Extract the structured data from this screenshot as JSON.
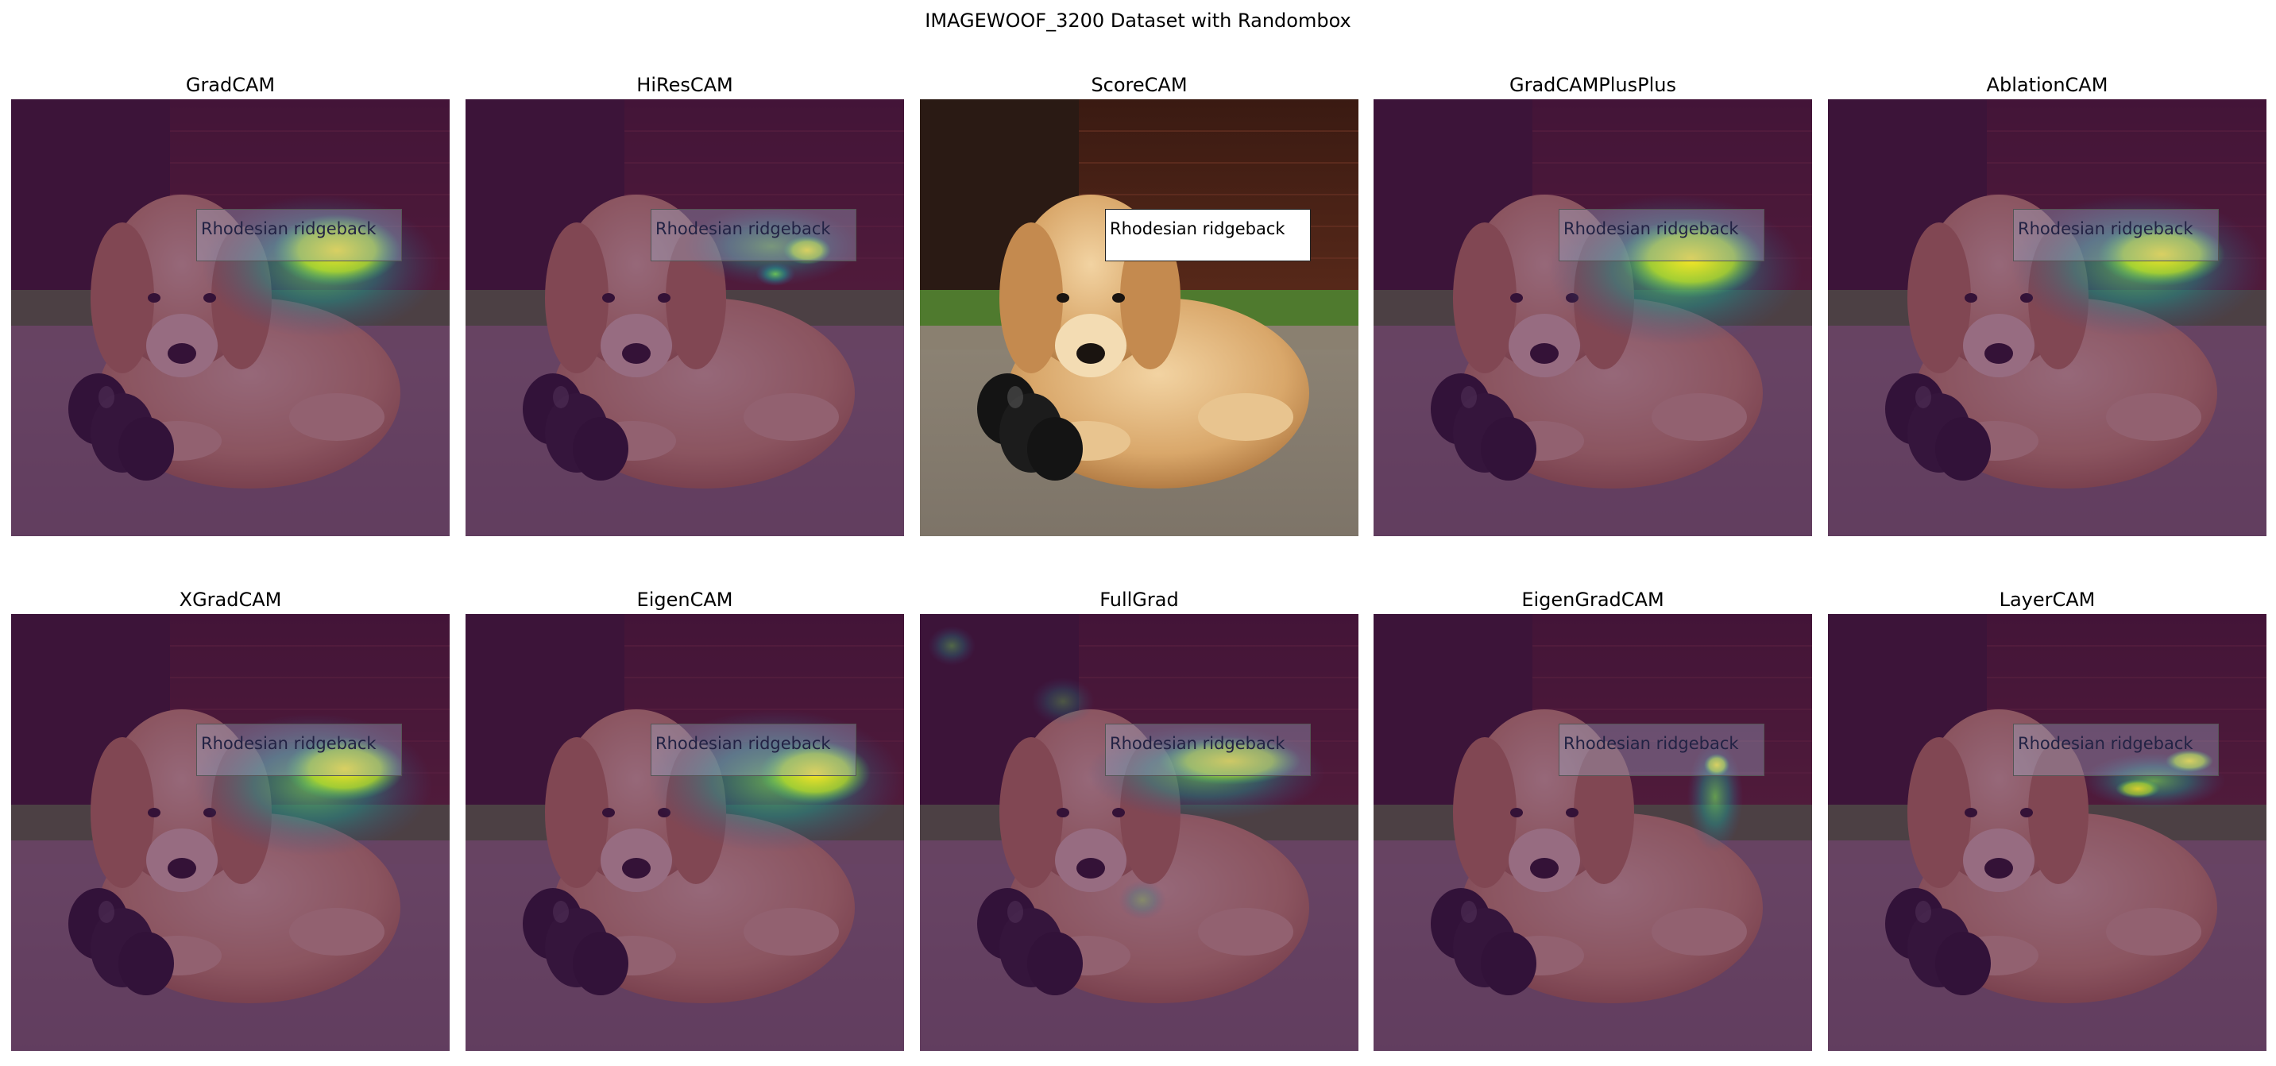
{
  "figure": {
    "title": "IMAGEWOOF_3200 Dataset with Randombox",
    "box_label": "Rhodesian ridgeback"
  },
  "panels": [
    {
      "method": "GradCAM",
      "overlay": "heatmap"
    },
    {
      "method": "HiResCAM",
      "overlay": "heatmap"
    },
    {
      "method": "ScoreCAM",
      "overlay": "none"
    },
    {
      "method": "GradCAMPlusPlus",
      "overlay": "heatmap"
    },
    {
      "method": "AblationCAM",
      "overlay": "heatmap"
    },
    {
      "method": "XGradCAM",
      "overlay": "heatmap"
    },
    {
      "method": "EigenCAM",
      "overlay": "heatmap"
    },
    {
      "method": "FullGrad",
      "overlay": "heatmap"
    },
    {
      "method": "EigenGradCAM",
      "overlay": "heatmap"
    },
    {
      "method": "LayerCAM",
      "overlay": "heatmap"
    }
  ],
  "colors": {
    "overlay_base": "#4a1058",
    "heat_mid": "#21918c",
    "heat_hot": "#fde725",
    "puppy": "#d9a76a",
    "toy": "#141414"
  }
}
